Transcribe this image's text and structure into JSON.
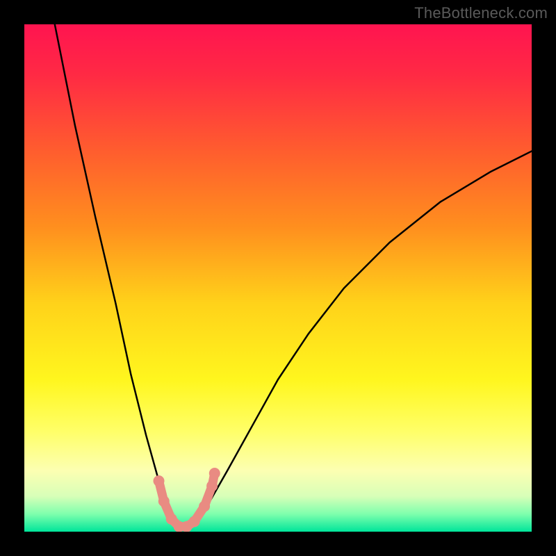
{
  "watermark": "TheBottleneck.com",
  "chart_data": {
    "type": "line",
    "title": "",
    "xlabel": "",
    "ylabel": "",
    "xlim": [
      0,
      100
    ],
    "ylim": [
      0,
      100
    ],
    "background_gradient": {
      "stops": [
        {
          "offset": 0.0,
          "color": "#ff1450"
        },
        {
          "offset": 0.1,
          "color": "#ff2a44"
        },
        {
          "offset": 0.25,
          "color": "#ff5d2e"
        },
        {
          "offset": 0.4,
          "color": "#ff8f1e"
        },
        {
          "offset": 0.55,
          "color": "#ffd21a"
        },
        {
          "offset": 0.7,
          "color": "#fff61e"
        },
        {
          "offset": 0.8,
          "color": "#ffff66"
        },
        {
          "offset": 0.88,
          "color": "#fcffb2"
        },
        {
          "offset": 0.93,
          "color": "#d8ffb8"
        },
        {
          "offset": 0.965,
          "color": "#7fffad"
        },
        {
          "offset": 1.0,
          "color": "#00e59a"
        }
      ]
    },
    "series": [
      {
        "name": "bottleneck-curve",
        "x": [
          6,
          10,
          14,
          18,
          21,
          24,
          26.5,
          28.5,
          30,
          31.5,
          33,
          36,
          40,
          45,
          50,
          56,
          63,
          72,
          82,
          92,
          100
        ],
        "y": [
          100,
          80,
          62,
          45,
          31,
          19,
          10,
          4,
          1.5,
          0.5,
          1.5,
          5,
          12,
          21,
          30,
          39,
          48,
          57,
          65,
          71,
          75
        ]
      }
    ],
    "markers": [
      {
        "x": 26.5,
        "y": 10,
        "color": "#e98b82"
      },
      {
        "x": 27.5,
        "y": 6,
        "color": "#e98b82"
      },
      {
        "x": 29.0,
        "y": 2.5,
        "color": "#e98b82"
      },
      {
        "x": 30.5,
        "y": 1.0,
        "color": "#e98b82"
      },
      {
        "x": 32.0,
        "y": 1.0,
        "color": "#e98b82"
      },
      {
        "x": 33.5,
        "y": 2.0,
        "color": "#e98b82"
      },
      {
        "x": 35.5,
        "y": 5.0,
        "color": "#e98b82"
      },
      {
        "x": 37.0,
        "y": 9.0,
        "color": "#e98b82"
      },
      {
        "x": 37.5,
        "y": 11.5,
        "color": "#e98b82"
      }
    ]
  }
}
